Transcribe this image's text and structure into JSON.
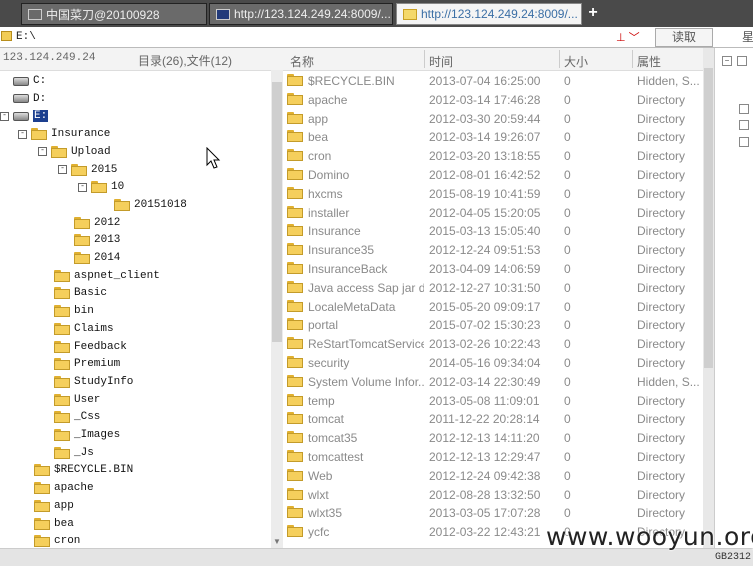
{
  "tabs": [
    {
      "label": "中国菜刀@20100928",
      "active": false,
      "icon": "window-icon"
    },
    {
      "label": "http://123.124.249.24:8009/...",
      "active": false,
      "icon": "terminal-icon"
    },
    {
      "label": "http://123.124.249.24:8009/...",
      "active": true,
      "icon": "folder-icon"
    }
  ],
  "tab_add": "+",
  "address": {
    "value": "E:\\",
    "arrows": "⊥ ﹀",
    "read_button": "读取",
    "extra_button": "星"
  },
  "tree": {
    "host": "123.124.249.24",
    "summary": "目录(26),文件(12)",
    "nodes": [
      {
        "label": "C:",
        "type": "drive",
        "depth": 0,
        "toggle": ""
      },
      {
        "label": "D:",
        "type": "drive",
        "depth": 0,
        "toggle": ""
      },
      {
        "label": "E:",
        "type": "drive",
        "depth": 0,
        "toggle": "-",
        "selected": true
      },
      {
        "label": "Insurance",
        "type": "folder",
        "depth": 1,
        "toggle": "-"
      },
      {
        "label": "Upload",
        "type": "folder",
        "depth": 2,
        "toggle": "-"
      },
      {
        "label": "2015",
        "type": "folder",
        "depth": 3,
        "toggle": "-"
      },
      {
        "label": "10",
        "type": "folder",
        "depth": 4,
        "toggle": "-"
      },
      {
        "label": "20151018",
        "type": "folder",
        "depth": 5,
        "toggle": ""
      },
      {
        "label": "2012",
        "type": "folder",
        "depth": 3,
        "toggle": ""
      },
      {
        "label": "2013",
        "type": "folder",
        "depth": 3,
        "toggle": ""
      },
      {
        "label": "2014",
        "type": "folder",
        "depth": 3,
        "toggle": ""
      },
      {
        "label": "aspnet_client",
        "type": "folder",
        "depth": 2,
        "toggle": ""
      },
      {
        "label": "Basic",
        "type": "folder",
        "depth": 2,
        "toggle": ""
      },
      {
        "label": "bin",
        "type": "folder",
        "depth": 2,
        "toggle": ""
      },
      {
        "label": "Claims",
        "type": "folder",
        "depth": 2,
        "toggle": ""
      },
      {
        "label": "Feedback",
        "type": "folder",
        "depth": 2,
        "toggle": ""
      },
      {
        "label": "Premium",
        "type": "folder",
        "depth": 2,
        "toggle": ""
      },
      {
        "label": "StudyInfo",
        "type": "folder",
        "depth": 2,
        "toggle": ""
      },
      {
        "label": "User",
        "type": "folder",
        "depth": 2,
        "toggle": ""
      },
      {
        "label": "_Css",
        "type": "folder",
        "depth": 2,
        "toggle": ""
      },
      {
        "label": "_Images",
        "type": "folder",
        "depth": 2,
        "toggle": ""
      },
      {
        "label": "_Js",
        "type": "folder",
        "depth": 2,
        "toggle": ""
      },
      {
        "label": "$RECYCLE.BIN",
        "type": "folder",
        "depth": 1,
        "toggle": ""
      },
      {
        "label": "apache",
        "type": "folder",
        "depth": 1,
        "toggle": ""
      },
      {
        "label": "app",
        "type": "folder",
        "depth": 1,
        "toggle": ""
      },
      {
        "label": "bea",
        "type": "folder",
        "depth": 1,
        "toggle": ""
      },
      {
        "label": "cron",
        "type": "folder",
        "depth": 1,
        "toggle": ""
      }
    ]
  },
  "files": {
    "columns": [
      "名称",
      "时间",
      "大小",
      "属性"
    ],
    "rows": [
      [
        "$RECYCLE.BIN",
        "2013-07-04 16:25:00",
        "0",
        "Hidden, S..."
      ],
      [
        "apache",
        "2012-03-14 17:46:28",
        "0",
        "Directory"
      ],
      [
        "app",
        "2012-03-30 20:59:44",
        "0",
        "Directory"
      ],
      [
        "bea",
        "2012-03-14 19:26:07",
        "0",
        "Directory"
      ],
      [
        "cron",
        "2012-03-20 13:18:55",
        "0",
        "Directory"
      ],
      [
        "Domino",
        "2012-08-01 16:42:52",
        "0",
        "Directory"
      ],
      [
        "hxcms",
        "2015-08-19 10:41:59",
        "0",
        "Directory"
      ],
      [
        "installer",
        "2012-04-05 15:20:05",
        "0",
        "Directory"
      ],
      [
        "Insurance",
        "2015-03-13 15:05:40",
        "0",
        "Directory"
      ],
      [
        "Insurance35",
        "2012-12-24 09:51:53",
        "0",
        "Directory"
      ],
      [
        "InsuranceBack",
        "2013-04-09 14:06:59",
        "0",
        "Directory"
      ],
      [
        "Java access Sap jar dll",
        "2012-12-27 10:31:50",
        "0",
        "Directory"
      ],
      [
        "LocaleMetaData",
        "2015-05-20 09:09:17",
        "0",
        "Directory"
      ],
      [
        "portal",
        "2015-07-02 15:30:23",
        "0",
        "Directory"
      ],
      [
        "ReStartTomcatService",
        "2013-02-26 10:22:43",
        "0",
        "Directory"
      ],
      [
        "security",
        "2014-05-16 09:34:04",
        "0",
        "Directory"
      ],
      [
        "System Volume Infor...",
        "2012-03-14 22:30:49",
        "0",
        "Hidden, S..."
      ],
      [
        "temp",
        "2013-05-08 11:09:01",
        "0",
        "Directory"
      ],
      [
        "tomcat",
        "2011-12-22 20:28:14",
        "0",
        "Directory"
      ],
      [
        "tomcat35",
        "2012-12-13 14:11:20",
        "0",
        "Directory"
      ],
      [
        "tomcattest",
        "2012-12-13 12:29:47",
        "0",
        "Directory"
      ],
      [
        "Web",
        "2012-12-24 09:42:38",
        "0",
        "Directory"
      ],
      [
        "wlxt",
        "2012-08-28 13:32:50",
        "0",
        "Directory"
      ],
      [
        "wlxt35",
        "2013-03-05 17:07:28",
        "0",
        "Directory"
      ],
      [
        "ycfc",
        "2012-03-22 12:43:21",
        "0",
        "Directory"
      ]
    ]
  },
  "status": {
    "encoding": "GB2312"
  },
  "watermark": "www.wooyun.org"
}
